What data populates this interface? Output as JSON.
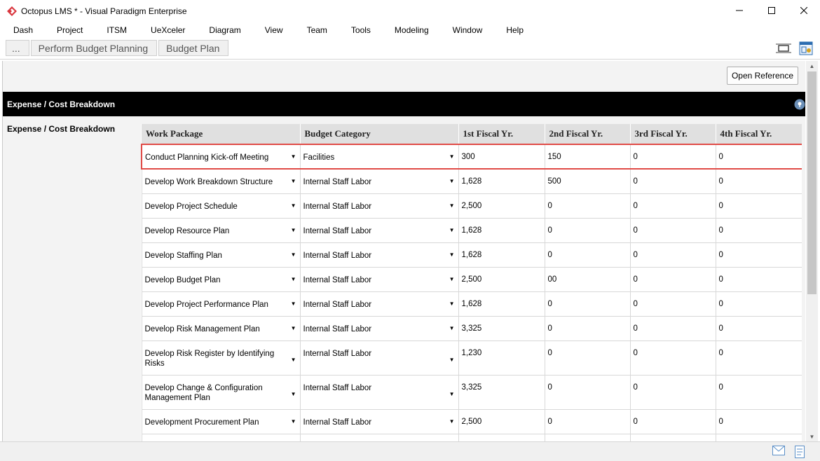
{
  "window": {
    "title": "Octopus LMS * - Visual Paradigm Enterprise",
    "controls": [
      "minimize",
      "maximize",
      "close"
    ]
  },
  "menu": [
    "Dash",
    "Project",
    "ITSM",
    "UeXceler",
    "Diagram",
    "View",
    "Team",
    "Tools",
    "Modeling",
    "Window",
    "Help"
  ],
  "breadcrumb": [
    "...",
    "Perform Budget Planning",
    "Budget Plan"
  ],
  "toolbar": {
    "open_reference": "Open Reference"
  },
  "section": {
    "title": "Expense / Cost Breakdown",
    "side_label": "Expense / Cost Breakdown"
  },
  "table": {
    "columns": [
      "Work Package",
      "Budget Category",
      "1st Fiscal Yr.",
      "2nd Fiscal Yr.",
      "3rd Fiscal Yr.",
      "4th Fiscal Yr."
    ],
    "rows": [
      {
        "work_package": "Conduct Planning Kick-off Meeting",
        "category": "Facilities",
        "y1": "300",
        "y2": "150",
        "y3": "0",
        "y4": "0"
      },
      {
        "work_package": "Develop Work Breakdown Structure",
        "category": "Internal Staff Labor",
        "y1": "1,628",
        "y2": "500",
        "y3": "0",
        "y4": "0"
      },
      {
        "work_package": "Develop Project Schedule",
        "category": "Internal Staff Labor",
        "y1": "2,500",
        "y2": "0",
        "y3": "0",
        "y4": "0"
      },
      {
        "work_package": "Develop Resource Plan",
        "category": "Internal Staff Labor",
        "y1": "1,628",
        "y2": "0",
        "y3": "0",
        "y4": "0"
      },
      {
        "work_package": "Develop Staffing Plan",
        "category": "Internal Staff Labor",
        "y1": "1,628",
        "y2": "0",
        "y3": "0",
        "y4": "0"
      },
      {
        "work_package": "Develop Budget Plan",
        "category": "Internal Staff Labor",
        "y1": "2,500",
        "y2": "00",
        "y3": "0",
        "y4": "0"
      },
      {
        "work_package": "Develop Project Performance Plan",
        "category": "Internal Staff Labor",
        "y1": "1,628",
        "y2": "0",
        "y3": "0",
        "y4": "0"
      },
      {
        "work_package": "Develop Risk Management Plan",
        "category": "Internal Staff Labor",
        "y1": "3,325",
        "y2": "0",
        "y3": "0",
        "y4": "0"
      },
      {
        "work_package": "Develop Risk Register by Identifying Risks",
        "category": "Internal Staff Labor",
        "y1": "1,230",
        "y2": "0",
        "y3": "0",
        "y4": "0"
      },
      {
        "work_package": "Develop Change & Configuration Management Plan",
        "category": "Internal Staff Labor",
        "y1": "3,325",
        "y2": "0",
        "y3": "0",
        "y4": "0"
      },
      {
        "work_package": "Development Procurement Plan",
        "category": "Internal Staff Labor",
        "y1": "2,500",
        "y2": "0",
        "y3": "0",
        "y4": "0"
      },
      {
        "work_package": "",
        "category": "",
        "y1": "",
        "y2": "",
        "y3": "",
        "y4": ""
      }
    ],
    "highlighted_row": 0
  },
  "colors": {
    "highlight": "#e04a46",
    "header_bg": "#e0e0e0",
    "section_bar": "#000000",
    "app_icon": "#d9363e"
  },
  "status_icons": [
    "mail-icon",
    "note-icon"
  ]
}
